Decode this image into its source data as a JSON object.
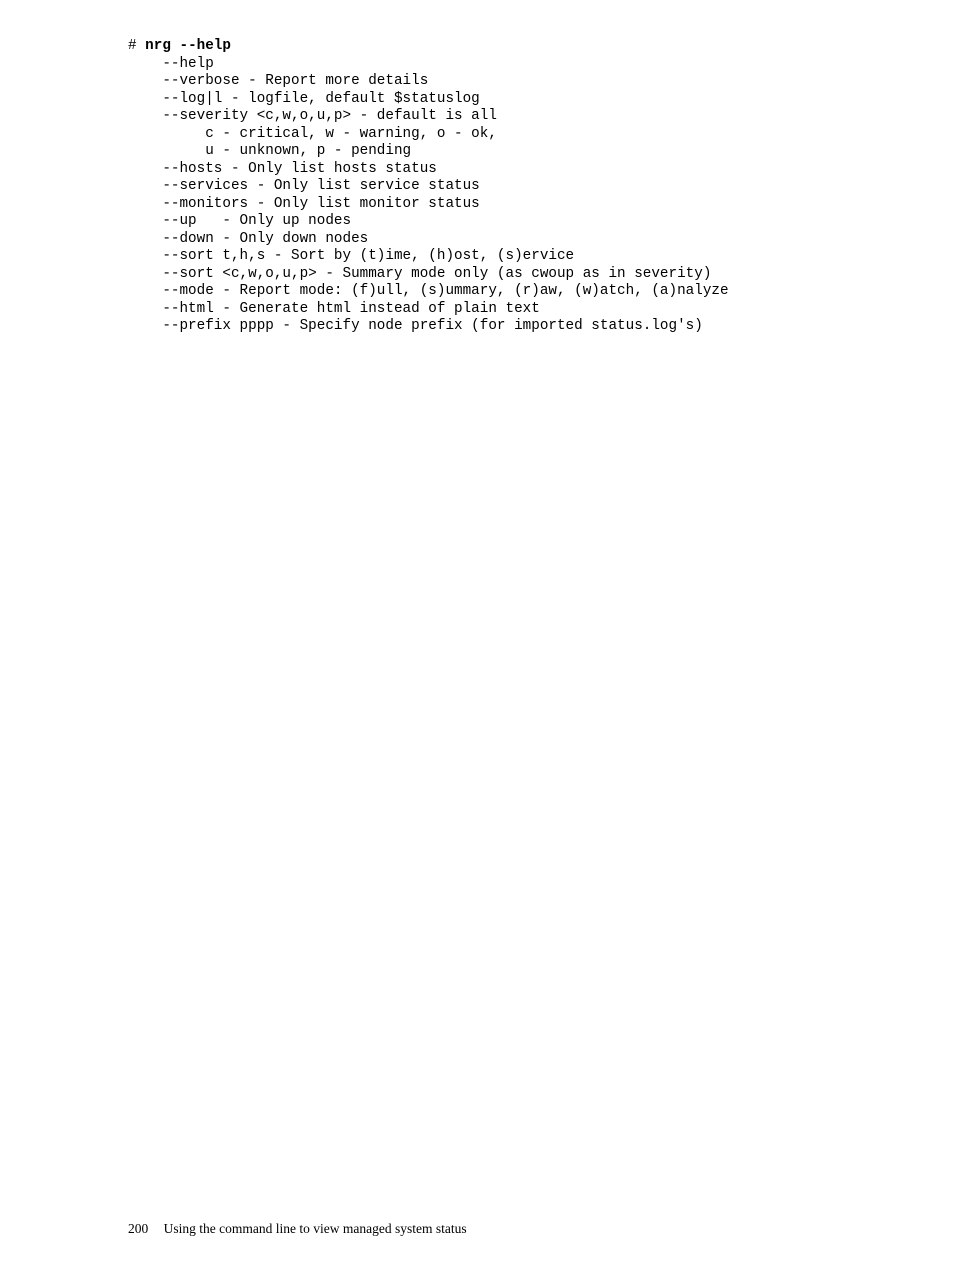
{
  "code": {
    "prompt": "# ",
    "command": "nrg --help",
    "lines": [
      "    --help",
      "    --verbose - Report more details",
      "    --log|l - logfile, default $statuslog",
      "    --severity <c,w,o,u,p> - default is all",
      "         c - critical, w - warning, o - ok,",
      "         u - unknown, p - pending",
      "    --hosts - Only list hosts status",
      "    --services - Only list service status",
      "    --monitors - Only list monitor status",
      "    --up   - Only up nodes",
      "    --down - Only down nodes",
      "    --sort t,h,s - Sort by (t)ime, (h)ost, (s)ervice",
      "    --sort <c,w,o,u,p> - Summary mode only (as cwoup as in severity)",
      "    --mode - Report mode: (f)ull, (s)ummary, (r)aw, (w)atch, (a)nalyze",
      "    --html - Generate html instead of plain text",
      "    --prefix pppp - Specify node prefix (for imported status.log's)"
    ]
  },
  "footer": {
    "page_number": "200",
    "title": "Using the command line to view managed system status"
  }
}
